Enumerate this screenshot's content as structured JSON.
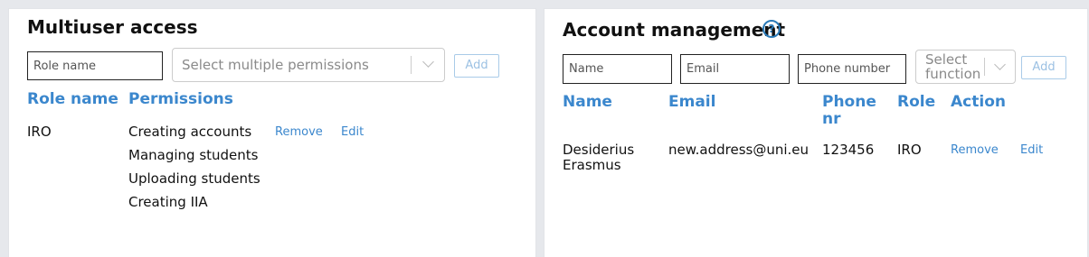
{
  "multiuser": {
    "title": "Multiuser access",
    "role_name_placeholder": "Role name",
    "permissions_placeholder": "Select multiple permissions",
    "add_label": "Add",
    "columns": [
      "Role name",
      "Permissions"
    ],
    "rows": [
      {
        "role": "IRO",
        "permissions": [
          "Creating accounts",
          "Managing students",
          "Uploading students",
          "Creating IIA"
        ],
        "remove_label": "Remove",
        "edit_label": "Edit"
      }
    ]
  },
  "account": {
    "title": "Account management",
    "help_icon": "help-icon",
    "help_glyph": "?",
    "name_placeholder": "Name",
    "email_placeholder": "Email",
    "phone_placeholder": "Phone number",
    "function_placeholder_line1": "Select",
    "function_placeholder_line2": "function",
    "add_label": "Add",
    "columns": [
      "Name",
      "Email",
      "Phone",
      "nr",
      "Role",
      "Action"
    ],
    "rows": [
      {
        "name_line1": "Desiderius",
        "name_line2": "Erasmus",
        "email": "new.address@uni.eu",
        "phone": "123456",
        "role": "IRO",
        "remove_label": "Remove",
        "edit_label": "Edit"
      }
    ]
  },
  "colors": {
    "accent": "#3b87cd",
    "background": "#e6e8ec",
    "panel": "#ffffff"
  }
}
